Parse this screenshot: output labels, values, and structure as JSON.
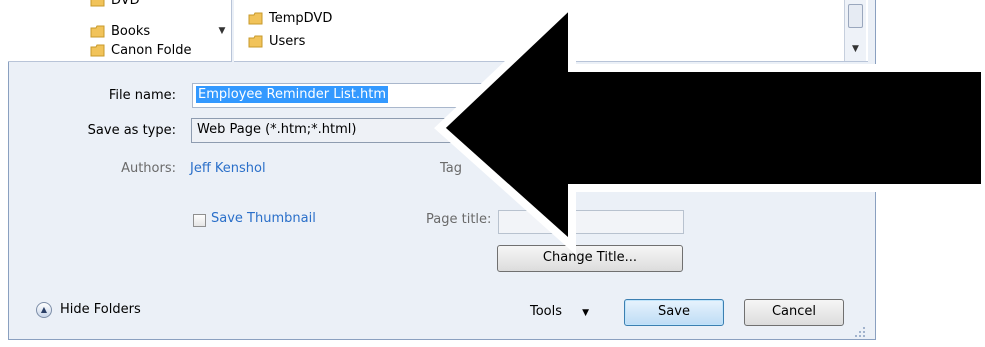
{
  "tree": {
    "items": [
      {
        "label": "DVD",
        "icon": "folder-icon"
      },
      {
        "label": "Books",
        "icon": "folder-icon"
      },
      {
        "label": "Canon Folde",
        "icon": "folder-icon"
      }
    ]
  },
  "list": {
    "items": [
      {
        "label": "TempDVD",
        "icon": "folder-icon"
      },
      {
        "label": "Users",
        "icon": "folder-icon"
      }
    ]
  },
  "form": {
    "file_name_label": "File name:",
    "file_name_value": "Employee Reminder List.htm",
    "save_as_type_label": "Save as type:",
    "save_as_type_value": "Web Page (*.htm;*.html)",
    "authors_label": "Authors:",
    "authors_value": "Jeff Kenshol",
    "tags_label": "Tag",
    "save_thumbnail_label": "Save Thumbnail",
    "page_title_label": "Page title:",
    "page_title_value": "",
    "change_title_label": "Change Title..."
  },
  "footer": {
    "hide_folders_label": "Hide Folders",
    "tools_label": "Tools",
    "save_label": "Save",
    "cancel_label": "Cancel"
  },
  "colors": {
    "dialog_background": "#ebf0f7",
    "link": "#2a6fc9",
    "selection": "#3399ff",
    "arrow_fill": "#000000"
  }
}
